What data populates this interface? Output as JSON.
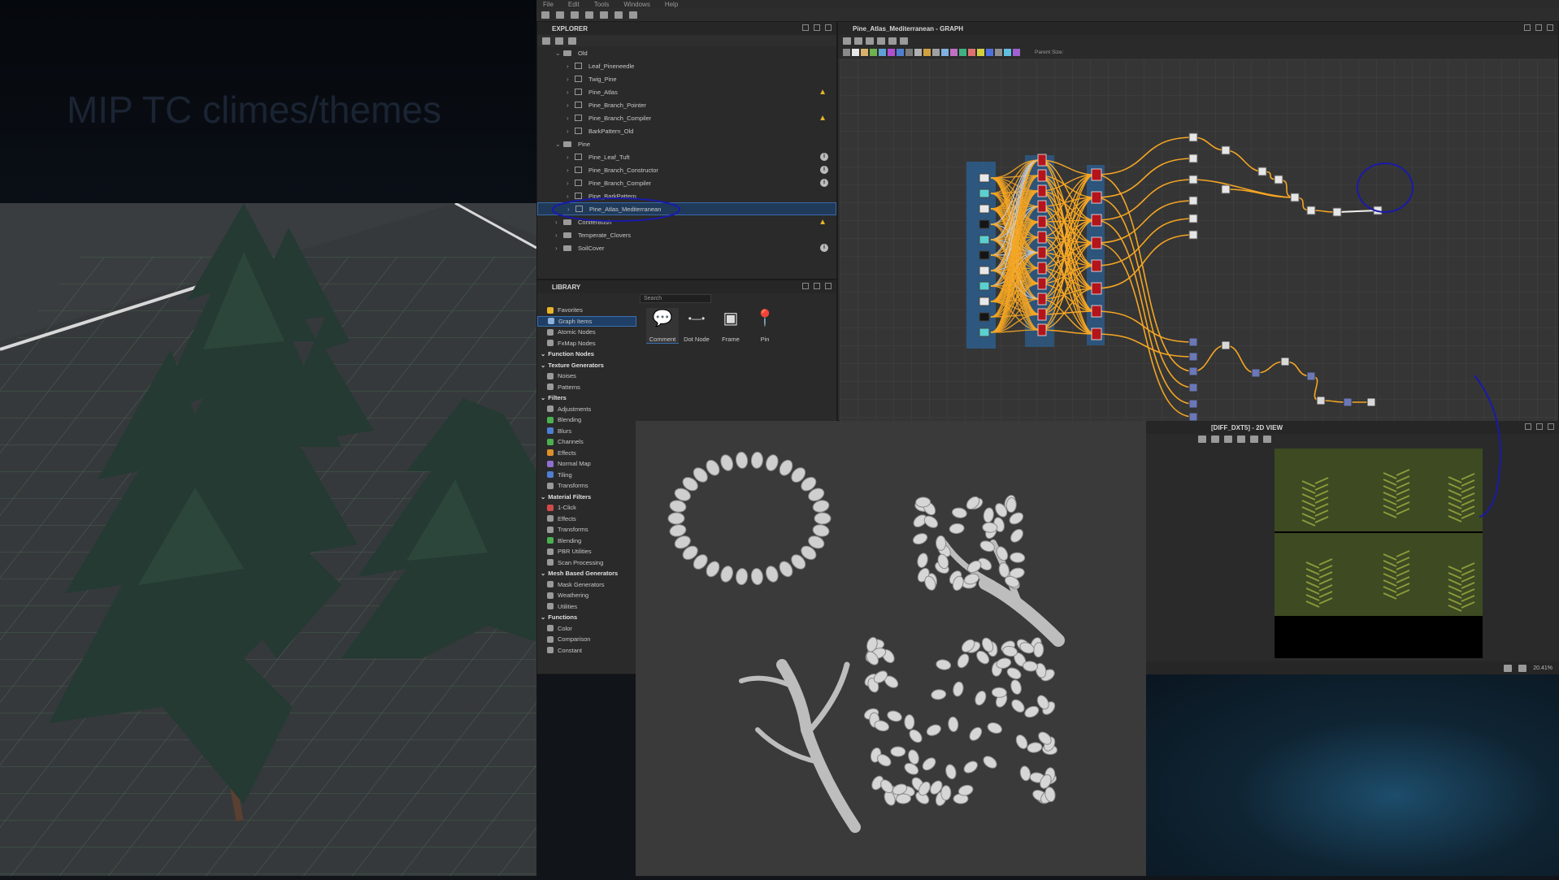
{
  "slide": {
    "title": "MIP TC climes/themes"
  },
  "menu": [
    "File",
    "Edit",
    "Tools",
    "Windows",
    "Help"
  ],
  "explorer": {
    "title": "EXPLORER",
    "rows": [
      {
        "label": "Old",
        "type": "folder",
        "indent": 1,
        "open": true
      },
      {
        "label": "Leaf_Pineneedle",
        "type": "graph",
        "indent": 2
      },
      {
        "label": "Twig_Pine",
        "type": "graph",
        "indent": 2
      },
      {
        "label": "Pine_Atlas",
        "type": "graph",
        "indent": 2,
        "badge": "warn"
      },
      {
        "label": "Pine_Branch_Pointer",
        "type": "graph",
        "indent": 2
      },
      {
        "label": "Pine_Branch_Compiler",
        "type": "graph",
        "indent": 2,
        "badge": "warn"
      },
      {
        "label": "BarkPattern_Old",
        "type": "graph",
        "indent": 2
      },
      {
        "label": "Pine",
        "type": "folder",
        "indent": 1,
        "open": true
      },
      {
        "label": "Pine_Leaf_Tuft",
        "type": "graph",
        "indent": 2,
        "badge": "info"
      },
      {
        "label": "Pine_Branch_Constructor",
        "type": "graph",
        "indent": 2,
        "badge": "info"
      },
      {
        "label": "Pine_Branch_Compiler",
        "type": "graph",
        "indent": 2,
        "badge": "info"
      },
      {
        "label": "Pine_BarkPattern",
        "type": "graph",
        "indent": 2
      },
      {
        "label": "Pine_Atlas_Mediterranean",
        "type": "graph",
        "indent": 2,
        "selected": true
      },
      {
        "label": "ConiferBush",
        "type": "folder",
        "indent": 1,
        "badge": "warn"
      },
      {
        "label": "Temperate_Clovers",
        "type": "folder",
        "indent": 1
      },
      {
        "label": "SoilCover",
        "type": "folder",
        "indent": 1,
        "badge": "info"
      }
    ]
  },
  "library": {
    "title": "LIBRARY",
    "search_placeholder": "Search",
    "categories": [
      {
        "label": "Favorites",
        "head": false,
        "color": "#e8b42a"
      },
      {
        "label": "Graph Items",
        "head": false,
        "color": "#8fb0d8",
        "selected": true
      },
      {
        "label": "Atomic Nodes",
        "head": false,
        "color": "#9a9a9a"
      },
      {
        "label": "FxMap Nodes",
        "head": false,
        "color": "#9a9a9a"
      },
      {
        "label": "Function Nodes",
        "head": true,
        "color": ""
      },
      {
        "label": "Texture Generators",
        "head": true,
        "color": ""
      },
      {
        "label": "Noises",
        "head": false,
        "color": "#9a9a9a"
      },
      {
        "label": "Patterns",
        "head": false,
        "color": "#9a9a9a"
      },
      {
        "label": "Filters",
        "head": true,
        "color": ""
      },
      {
        "label": "Adjustments",
        "head": false,
        "color": "#9a9a9a"
      },
      {
        "label": "Blending",
        "head": false,
        "color": "#4caf50"
      },
      {
        "label": "Blurs",
        "head": false,
        "color": "#4f7fd0"
      },
      {
        "label": "Channels",
        "head": false,
        "color": "#4caf50"
      },
      {
        "label": "Effects",
        "head": false,
        "color": "#e0902a"
      },
      {
        "label": "Normal Map",
        "head": false,
        "color": "#8f6fd0"
      },
      {
        "label": "Tiling",
        "head": false,
        "color": "#4f7fd0"
      },
      {
        "label": "Transforms",
        "head": false,
        "color": "#9a9a9a"
      },
      {
        "label": "Material Filters",
        "head": true,
        "color": ""
      },
      {
        "label": "1-Click",
        "head": false,
        "color": "#d04a4a"
      },
      {
        "label": "Effects",
        "head": false,
        "color": "#9a9a9a"
      },
      {
        "label": "Transforms",
        "head": false,
        "color": "#9a9a9a"
      },
      {
        "label": "Blending",
        "head": false,
        "color": "#4caf50"
      },
      {
        "label": "PBR Utilities",
        "head": false,
        "color": "#9a9a9a"
      },
      {
        "label": "Scan Processing",
        "head": false,
        "color": "#9a9a9a"
      },
      {
        "label": "Mesh Based Generators",
        "head": true,
        "color": ""
      },
      {
        "label": "Mask Generators",
        "head": false,
        "color": "#9a9a9a"
      },
      {
        "label": "Weathering",
        "head": false,
        "color": "#9a9a9a"
      },
      {
        "label": "Utilities",
        "head": false,
        "color": "#9a9a9a"
      },
      {
        "label": "Functions",
        "head": true,
        "color": ""
      },
      {
        "label": "Color",
        "head": false,
        "color": "#9a9a9a"
      },
      {
        "label": "Comparison",
        "head": false,
        "color": "#9a9a9a"
      },
      {
        "label": "Constant",
        "head": false,
        "color": "#9a9a9a"
      }
    ],
    "items": [
      {
        "label": "Comment",
        "icon": "comment-icon"
      },
      {
        "label": "Dot Node",
        "icon": "dot-node-icon"
      },
      {
        "label": "Frame",
        "icon": "frame-icon"
      },
      {
        "label": "Pin",
        "icon": "pin-icon"
      }
    ]
  },
  "graph": {
    "title": "Pine_Atlas_Mediterranean - GRAPH",
    "parent_size_label": "Parent Size:"
  },
  "view2d": {
    "title": "[DIFF_DXT5] - 2D VIEW",
    "zoom": "20.41%"
  },
  "colors": {
    "wire": "#f5a623",
    "node_red": "#b3151b",
    "frame_blue": "#2c5d8c",
    "annotation": "#1a1aa8"
  }
}
